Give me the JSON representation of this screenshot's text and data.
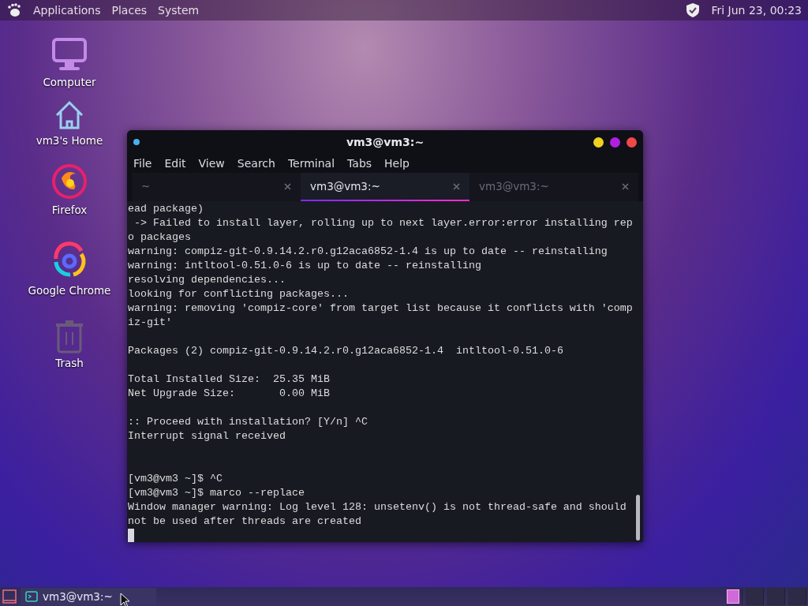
{
  "top_panel": {
    "menus": [
      "Applications",
      "Places",
      "System"
    ],
    "clock": "Fri Jun 23, 00:23"
  },
  "desktop_icons": [
    {
      "kind": "computer",
      "label": "Computer"
    },
    {
      "kind": "home",
      "label": "vm3's Home"
    },
    {
      "kind": "firefox",
      "label": "Firefox"
    },
    {
      "kind": "chrome",
      "label": "Google Chrome"
    },
    {
      "kind": "trash",
      "label": "Trash"
    }
  ],
  "window": {
    "title": "vm3@vm3:~",
    "menu": [
      "File",
      "Edit",
      "View",
      "Search",
      "Terminal",
      "Tabs",
      "Help"
    ],
    "tabs": [
      {
        "label": "~",
        "selected": false
      },
      {
        "label": "vm3@vm3:~",
        "selected": true
      },
      {
        "label": "vm3@vm3:~",
        "selected": false
      }
    ],
    "output": [
      {
        "kind": "text",
        "lines": [
          "ead package)",
          " -> Failed to install layer, rolling up to next layer.error:error installing rep",
          "o packages",
          "warning: compiz-git-0.9.14.2.r0.g12aca6852-1.4 is up to date -- reinstalling",
          "warning: intltool-0.51.0-6 is up to date -- reinstalling",
          "resolving dependencies...",
          "looking for conflicting packages...",
          "warning: removing 'compiz-core' from target list because it conflicts with 'comp",
          "iz-git'"
        ]
      },
      {
        "kind": "blank"
      },
      {
        "kind": "text",
        "lines": [
          "Packages (2) compiz-git-0.9.14.2.r0.g12aca6852-1.4  intltool-0.51.0-6"
        ]
      },
      {
        "kind": "blank"
      },
      {
        "kind": "text",
        "lines": [
          "Total Installed Size:  25.35 MiB",
          "Net Upgrade Size:       0.00 MiB"
        ]
      },
      {
        "kind": "blank"
      },
      {
        "kind": "text",
        "lines": [
          ":: Proceed with installation? [Y/n] ^C",
          "Interrupt signal received"
        ]
      },
      {
        "kind": "blank"
      },
      {
        "kind": "blank"
      },
      {
        "kind": "text",
        "lines": [
          "[vm3@vm3 ~]$ ^C",
          "[vm3@vm3 ~]$ marco --replace",
          "Window manager warning: Log level 128: unsetenv() is not thread-safe and should",
          "not be used after threads are created"
        ]
      },
      {
        "kind": "cursor"
      }
    ]
  },
  "taskbar": {
    "tasks": [
      {
        "label": "vm3@vm3:~",
        "selected": false
      }
    ],
    "workspaces": [
      {
        "selected": true
      },
      {
        "selected": false
      },
      {
        "selected": false
      },
      {
        "selected": false
      }
    ]
  }
}
